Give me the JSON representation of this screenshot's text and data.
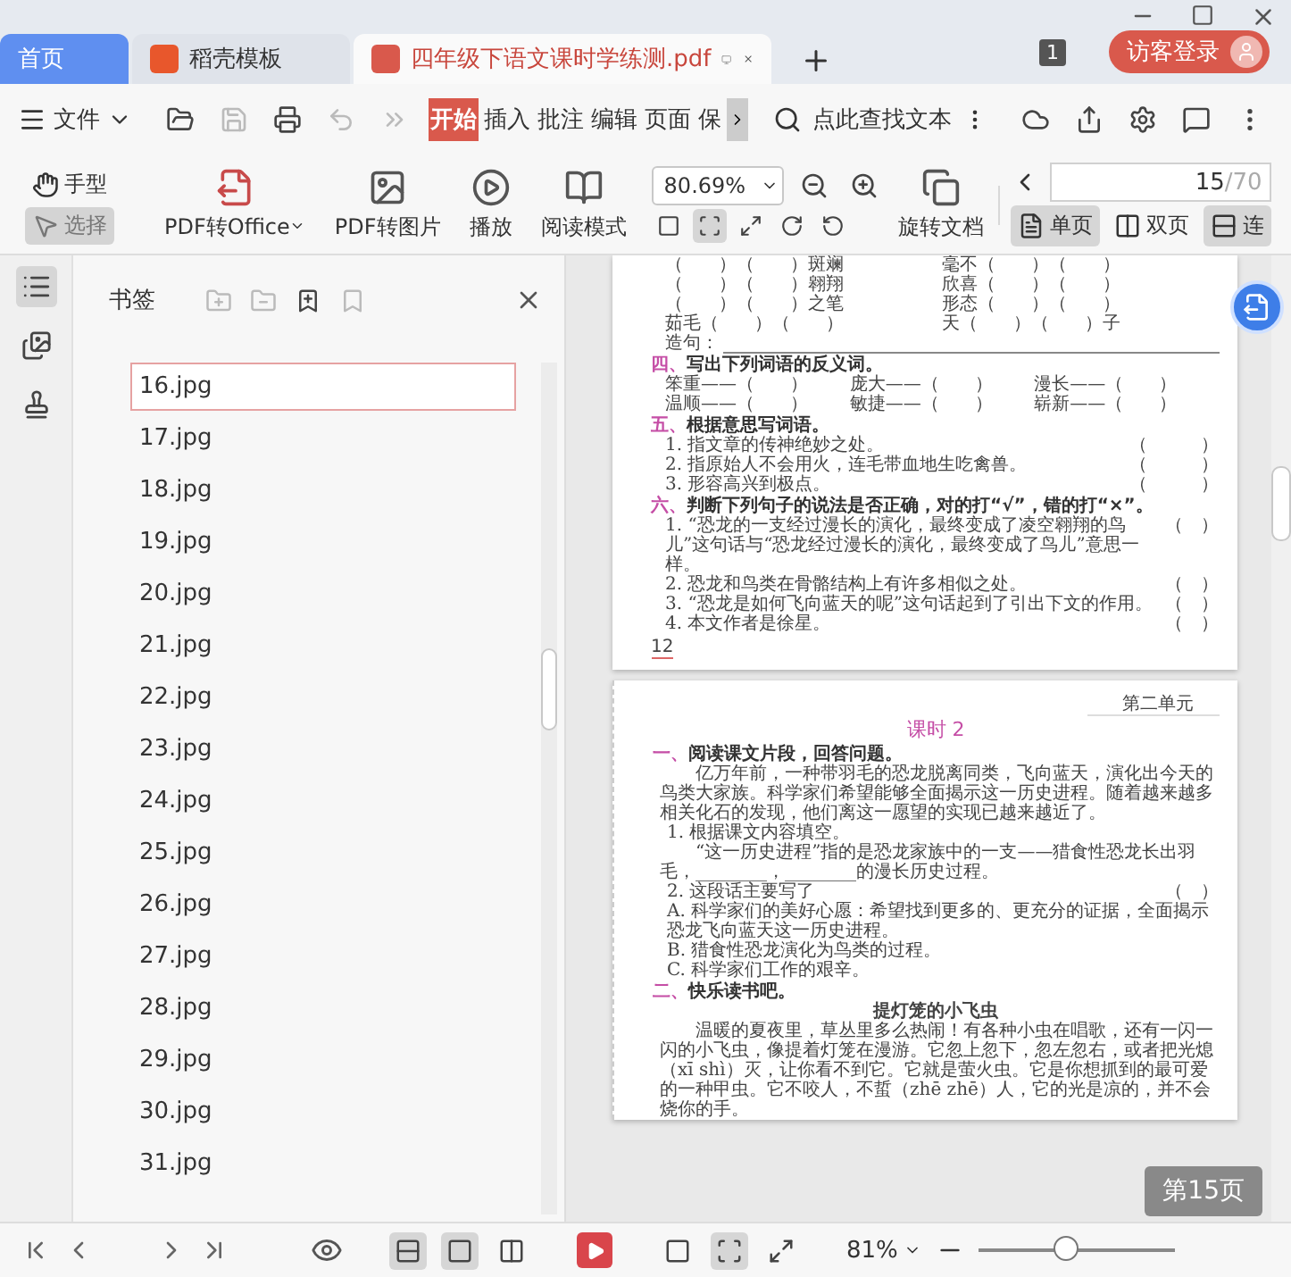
{
  "tabs": [
    {
      "label": "首页",
      "kind": "home",
      "selected": false
    },
    {
      "label": "稻壳模板",
      "kind": "template",
      "selected": false
    },
    {
      "label": "四年级下语文课时学练测.pdf",
      "kind": "document",
      "selected": true
    }
  ],
  "window_count": "1",
  "login_button": "访客登录",
  "menu": {
    "file": "文件",
    "ribbon_tabs": [
      {
        "label": "开始",
        "selected": true
      },
      {
        "label": "插入",
        "selected": false
      },
      {
        "label": "批注",
        "selected": false
      },
      {
        "label": "编辑",
        "selected": false
      },
      {
        "label": "页面",
        "selected": false
      },
      {
        "label": "保",
        "selected": false
      }
    ],
    "search_placeholder": "点此查找文本"
  },
  "toolbar": {
    "tools": [
      {
        "label": "手型",
        "kind": "hand",
        "selected": false
      },
      {
        "label": "选择",
        "kind": "select",
        "selected": true
      }
    ],
    "actions": [
      {
        "label": "PDF转Office",
        "kind": "office",
        "dropdown": true
      },
      {
        "label": "PDF转图片",
        "kind": "image",
        "dropdown": false
      },
      {
        "label": "播放",
        "kind": "play",
        "dropdown": false
      },
      {
        "label": "阅读模式",
        "kind": "read",
        "dropdown": false
      }
    ],
    "zoom": "80.69%",
    "rotate": "旋转文档",
    "fit_buttons": [
      {
        "kind": "actual",
        "selected": false
      },
      {
        "kind": "fit",
        "selected": true
      },
      {
        "kind": "width",
        "selected": false
      }
    ],
    "page_current": "15",
    "page_total": "/70",
    "view_modes": [
      {
        "label": "单页",
        "kind": "single",
        "selected": true
      },
      {
        "label": "双页",
        "kind": "double",
        "selected": false
      },
      {
        "label": "连",
        "kind": "continuous",
        "selected": true
      }
    ]
  },
  "sidebar": {
    "panels": [
      {
        "kind": "bookmarks",
        "selected": true
      },
      {
        "kind": "thumbnails",
        "selected": false
      },
      {
        "kind": "stamps",
        "selected": false
      }
    ],
    "title": "书签",
    "bookmarks": [
      {
        "label": "16.jpg",
        "selected": true
      },
      {
        "label": "17.jpg",
        "selected": false
      },
      {
        "label": "18.jpg",
        "selected": false
      },
      {
        "label": "19.jpg",
        "selected": false
      },
      {
        "label": "20.jpg",
        "selected": false
      },
      {
        "label": "21.jpg",
        "selected": false
      },
      {
        "label": "22.jpg",
        "selected": false
      },
      {
        "label": "23.jpg",
        "selected": false
      },
      {
        "label": "24.jpg",
        "selected": false
      },
      {
        "label": "25.jpg",
        "selected": false
      },
      {
        "label": "26.jpg",
        "selected": false
      },
      {
        "label": "27.jpg",
        "selected": false
      },
      {
        "label": "28.jpg",
        "selected": false
      },
      {
        "label": "29.jpg",
        "selected": false
      },
      {
        "label": "30.jpg",
        "selected": false
      },
      {
        "label": "31.jpg",
        "selected": false
      }
    ]
  },
  "document": {
    "pages": [
      {
        "lines": [
          {
            "kind": "row",
            "cells": [
              "（　　）（　　）斑斓",
              "毫不（　　）（　　）"
            ]
          },
          {
            "kind": "row",
            "cells": [
              "（　　）（　　）翱翔",
              "欣喜（　　）（　　）"
            ]
          },
          {
            "kind": "row",
            "cells": [
              "（　　）（　　）之笔",
              "形态（　　）（　　）"
            ]
          },
          {
            "kind": "row",
            "cells": [
              "茹毛（　　）（　　）",
              "天（　　）（　　）子"
            ]
          },
          {
            "kind": "fill",
            "text": "造句："
          },
          {
            "kind": "heading",
            "num": "四、",
            "text": "写出下列词语的反义词。"
          },
          {
            "kind": "row",
            "cells": [
              "笨重——（　　）",
              "庞大——（　　）",
              "漫长——（　　）"
            ]
          },
          {
            "kind": "row",
            "cells": [
              "温顺——（　　）",
              "敏捷——（　　）",
              "崭新——（　　）"
            ]
          },
          {
            "kind": "heading",
            "num": "五、",
            "text": "根据意思写词语。"
          },
          {
            "kind": "item",
            "text": "1. 指文章的传神绝妙之处。",
            "answer": "（　　　）"
          },
          {
            "kind": "item",
            "text": "2. 指原始人不会用火，连毛带血地生吃禽兽。",
            "answer": "（　　　）"
          },
          {
            "kind": "item",
            "text": "3. 形容高兴到极点。",
            "answer": "（　　　）"
          },
          {
            "kind": "heading",
            "num": "六、",
            "text": "判断下列句子的说法是否正确，对的打“√”，错的打“×”。"
          },
          {
            "kind": "item",
            "text": "1. “恐龙的一支经过漫长的演化，最终变成了凌空翱翔的鸟儿”这句话与“恐龙经过漫长的演化，最终变成了鸟儿”意思一样。",
            "answer": "（　）"
          },
          {
            "kind": "item",
            "text": "2. 恐龙和鸟类在骨骼结构上有许多相似之处。",
            "answer": "（　）"
          },
          {
            "kind": "item",
            "text": "3. “恐龙是如何飞向蓝天的呢”这句话起到了引出下文的作用。",
            "answer": "（　）"
          },
          {
            "kind": "item",
            "text": "4. 本文作者是徐星。",
            "answer": "（　）"
          },
          {
            "kind": "number",
            "text": "12"
          }
        ]
      },
      {
        "lines": [
          {
            "kind": "unit",
            "text": "第二单元"
          },
          {
            "kind": "title",
            "text": "课时 2"
          },
          {
            "kind": "heading",
            "num": "一、",
            "text": "阅读课文片段，回答问题。"
          },
          {
            "kind": "para",
            "text": "亿万年前，一种带羽毛的恐龙脱离同类，飞向蓝天，演化出今天的鸟类大家族。科学家们希望能够全面揭示这一历史进程。随着越来越多相关化石的发现，他们离这一愿望的实现已越来越近了。"
          },
          {
            "kind": "item",
            "text": "1. 根据课文内容填空。"
          },
          {
            "kind": "para",
            "text": "“这一历史进程”指的是恐龙家族中的一支——猎食性恐龙长出羽毛，________，________的漫长历史过程。"
          },
          {
            "kind": "item",
            "text": "2. 这段话主要写了",
            "answer": "（　）"
          },
          {
            "kind": "item",
            "text": "A. 科学家们的美好心愿：希望找到更多的、更充分的证据，全面揭示恐龙飞向蓝天这一历史进程。"
          },
          {
            "kind": "item",
            "text": "B. 猎食性恐龙演化为鸟类的过程。"
          },
          {
            "kind": "item",
            "text": "C. 科学家们工作的艰辛。"
          },
          {
            "kind": "heading",
            "num": "二、",
            "text": "快乐读书吧。"
          },
          {
            "kind": "subtitle",
            "text": "提灯笼的小飞虫"
          },
          {
            "kind": "para",
            "text": "温暖的夏夜里，草丛里多么热闹！有各种小虫在唱歌，还有一闪一闪的小飞虫，像提着灯笼在漫游。它忽上忽下，忽左忽右，或者把光熄（xī shì）灭，让你看不到它。它就是萤火虫。它是你想抓到的最可爱的一种甲虫。它不咬人，不蜇（zhē zhē）人，它的光是凉的，并不会烧你的手。"
          }
        ]
      }
    ]
  },
  "page_tooltip": "第15页",
  "status_bar": {
    "layout_buttons": [
      {
        "kind": "continuous",
        "selected": true
      },
      {
        "kind": "single",
        "selected": true
      },
      {
        "kind": "double",
        "selected": false
      }
    ],
    "fit_buttons": [
      {
        "kind": "actual",
        "selected": false
      },
      {
        "kind": "fit",
        "selected": true
      },
      {
        "kind": "width",
        "selected": false
      }
    ],
    "zoom": "81%",
    "zoom_slider": {
      "level": 0.45
    }
  }
}
